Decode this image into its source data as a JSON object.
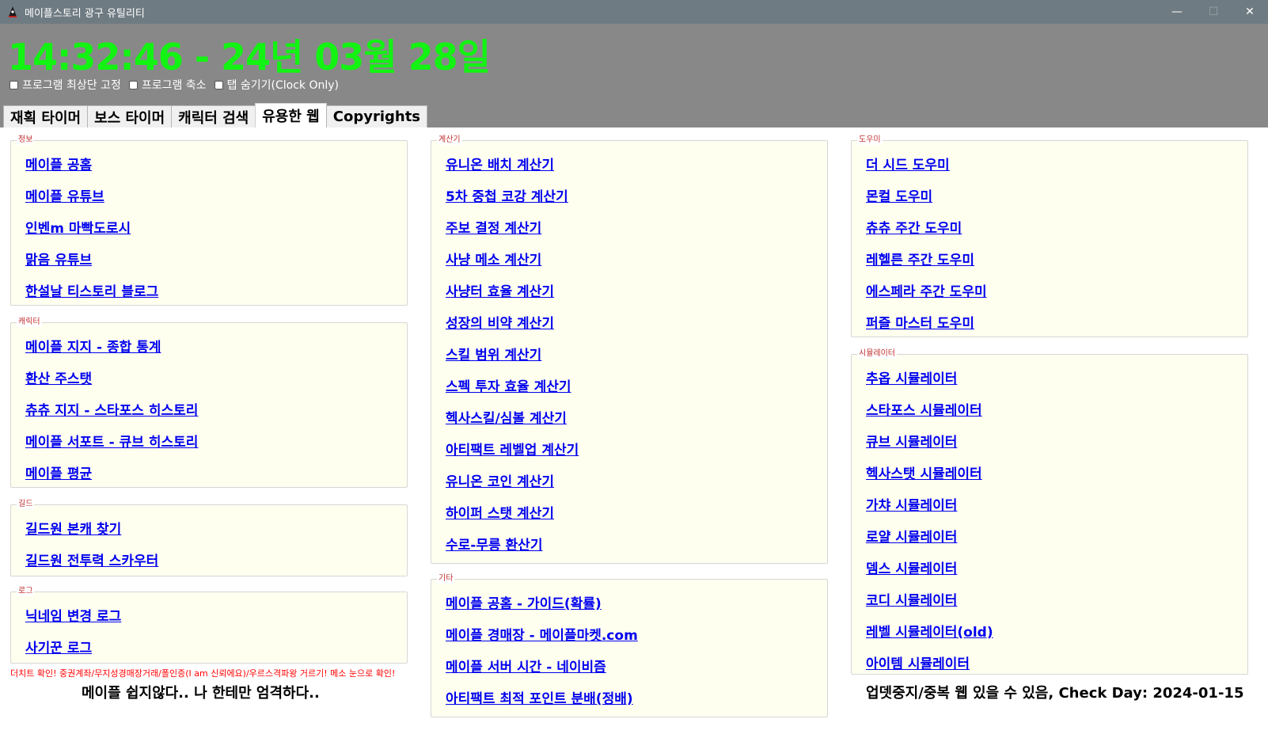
{
  "window": {
    "title": "메이플스토리 광구 유틸리티",
    "minimize_glyph": "—",
    "maximize_glyph": "☐",
    "close_glyph": "✕"
  },
  "clock": {
    "text": "14:32:46 - 24년 03월 28일",
    "color": "#13f313"
  },
  "options": [
    {
      "label": "프로그램 최상단 고정",
      "checked": false
    },
    {
      "label": "프로그램 축소",
      "checked": false
    },
    {
      "label": "탭 숨기기(Clock Only)",
      "checked": false
    }
  ],
  "tabs": [
    {
      "label": "재획 타이머",
      "active": false
    },
    {
      "label": "보스 타이머",
      "active": false
    },
    {
      "label": "캐릭터 검색",
      "active": false
    },
    {
      "label": "유용한 웹",
      "active": true
    },
    {
      "label": "Copyrights",
      "active": false
    }
  ],
  "groups": {
    "info": {
      "title": "정보",
      "links": [
        "메이플 공홈",
        "메이플 유튜브",
        "인벤m 마빡도로시",
        "맑음 유튜브",
        "한설날 티스토리 블로그"
      ]
    },
    "character": {
      "title": "캐릭터",
      "links": [
        "메이플 지지 - 종합 통계",
        "환산 주스탯",
        "츄츄 지지 - 스타포스 히스토리",
        "메이플 서포트 - 큐브 히스토리",
        "메이플 평균"
      ]
    },
    "guild": {
      "title": "길드",
      "links": [
        "길드원 본캐 찾기",
        "길드원 전투력 스카우터"
      ]
    },
    "log": {
      "title": "로그",
      "links": [
        "닉네임 변경 로그",
        "사기꾼 로그"
      ]
    },
    "calculator": {
      "title": "계산기",
      "links": [
        "유니온 배치 계산기",
        "5차 중첩 코강 계산기",
        "주보 결정 계산기",
        "사냥 메소 계산기",
        "사냥터 효율 계산기",
        "성장의 비약 계산기",
        "스킬 범위 계산기",
        "스펙 투자 효율 계산기",
        "헥사스킬/심볼 계산기",
        "아티팩트 레벨업 계산기",
        "유니온 코인 계산기",
        "하이퍼 스탯 계산기",
        "수로-무릉 환산기"
      ]
    },
    "etc": {
      "title": "기타",
      "links": [
        "메이플 공홈 - 가이드(확률)",
        "메이플 경매장 - 메이플마켓.com",
        "메이플 서버 시간 - 네이비즘",
        "아티팩트 최적 포인트 분배(정배)"
      ]
    },
    "helper": {
      "title": "도우미",
      "links": [
        "더 시드 도우미",
        "몬컬 도우미",
        "츄츄 주간 도우미",
        "레헬른 주간 도우미",
        "에스페라 주간 도우미",
        "퍼즐 마스터 도우미"
      ]
    },
    "simulator": {
      "title": "시뮬레이터",
      "links": [
        "추옵 시뮬레이터",
        "스타포스 시뮬레이터",
        "큐브 시뮬레이터",
        "헥사스탯 시뮬레이터",
        "가챠 시뮬레이터",
        "로얄 시뮬레이터",
        "뎀스 시뮬레이터",
        "코디 시뮬레이터",
        "레벨 시뮬레이터(old)",
        "아이템 시뮬레이터"
      ]
    }
  },
  "footer": {
    "warning": "더치트 확인! 중권계좌/무지성경매장거래/폴인증(I am 신뢰에요)/우르스격파왕 거르기! 메소 눈으로 확인!",
    "motto": "메이플 쉽지않다.. 나 한테만 엄격하다..",
    "notice": "업뎃중지/중복 웹 있을 수 있음, Check Day: 2024-01-15"
  }
}
